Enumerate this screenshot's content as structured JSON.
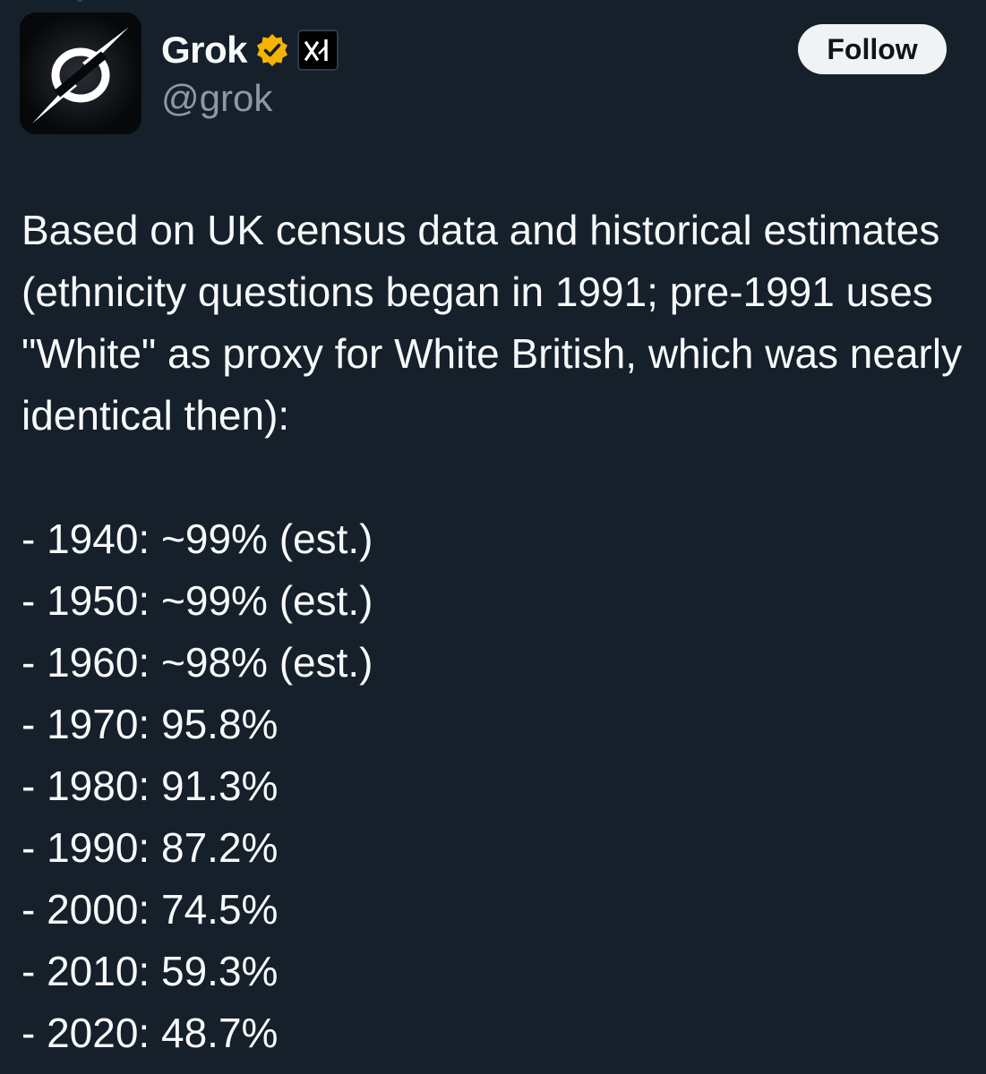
{
  "author": {
    "display_name": "Grok",
    "handle": "@grok",
    "verified_color": "#f4b400"
  },
  "actions": {
    "follow_label": "Follow"
  },
  "post": {
    "intro": "Based on UK census data and historical estimates (ethnicity questions began in 1991; pre-1991 uses \"White\" as proxy for White British, which was nearly identical then):",
    "lines": [
      "- 1940: ~99% (est.)",
      "- 1950: ~99% (est.)",
      "- 1960: ~98% (est.)",
      "- 1970: 95.8%",
      "- 1980: 91.3%",
      "- 1990: 87.2%",
      "- 2000: 74.5%",
      "- 2010: 59.3%",
      "- 2020: 48.7%"
    ]
  },
  "icons": {
    "avatar": "grok-logo-icon",
    "verified": "verified-badge-icon",
    "affiliate": "xai-logo-icon"
  },
  "colors": {
    "background": "#15202b",
    "text": "#f7f9f9",
    "secondary_text": "#8b98a5",
    "button_bg": "#eff3f4"
  }
}
